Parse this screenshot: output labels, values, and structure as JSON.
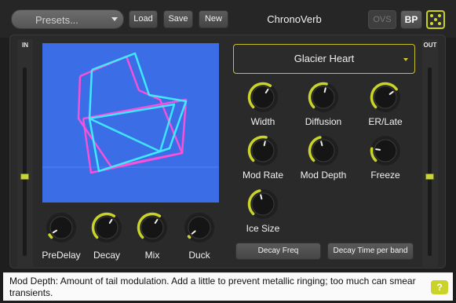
{
  "header": {
    "presets_label": "Presets...",
    "load_label": "Load",
    "save_label": "Save",
    "new_label": "New",
    "title": "ChronoVerb",
    "ovs_label": "OVS",
    "bp_label": "BP"
  },
  "meters": {
    "in_label": "IN",
    "in_level": 0.42,
    "out_label": "OUT",
    "out_level": 0.42
  },
  "algorithm": {
    "selected": "Glacier Heart"
  },
  "knobs": {
    "width": {
      "label": "Width",
      "value": 0.62
    },
    "diffusion": {
      "label": "Diffusion",
      "value": 0.55
    },
    "er_late": {
      "label": "ER/Late",
      "value": 0.7
    },
    "mod_rate": {
      "label": "Mod Rate",
      "value": 0.55
    },
    "mod_depth": {
      "label": "Mod Depth",
      "value": 0.45
    },
    "freeze": {
      "label": "Freeze",
      "value": 0.2
    },
    "ice_size": {
      "label": "Ice Size",
      "value": 0.45
    },
    "predelay": {
      "label": "PreDelay",
      "value": 0.05
    },
    "decay": {
      "label": "Decay",
      "value": 0.62
    },
    "mix": {
      "label": "Mix",
      "value": 0.62
    },
    "duck": {
      "label": "Duck",
      "value": 0.0
    }
  },
  "buttons": {
    "decay_freq": "Decay Freq",
    "decay_time_per_band": "Decay Time per band"
  },
  "help": {
    "text": "Mod Depth: Amount of tail modulation. Add a little to prevent metallic ringing; too much can smear transients.",
    "button_label": "?"
  },
  "colors": {
    "accent": "#c9d32a",
    "display_bg": "#3b6ee6",
    "shape_magenta": "#ff4fd8",
    "shape_cyan": "#3ff0ff"
  }
}
